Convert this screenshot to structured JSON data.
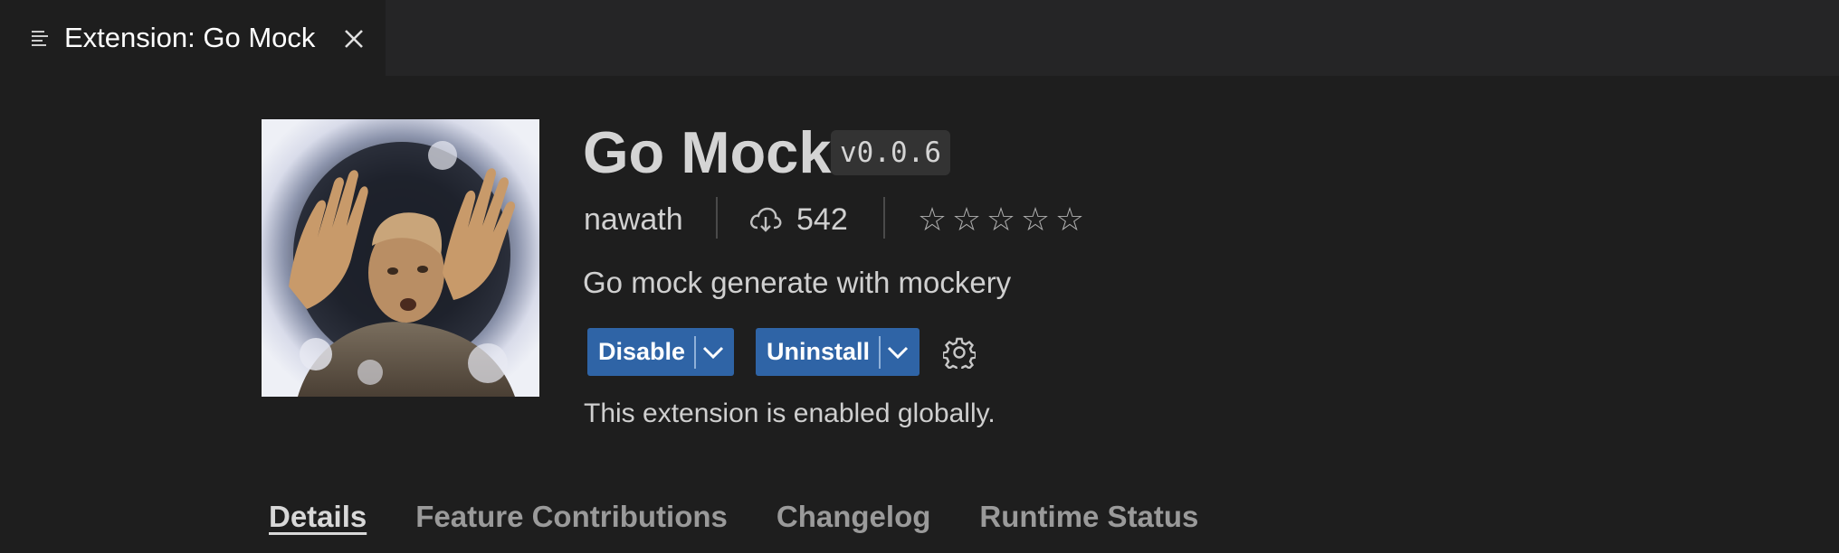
{
  "tab": {
    "title": "Extension: Go Mock",
    "icon": "preview-lines-icon",
    "close_icon": "close-icon"
  },
  "extension": {
    "image_alt": "extension-icon-image",
    "name": "Go Mock",
    "version": "v0.0.6",
    "publisher": "nawath",
    "install_count": "542",
    "rating": {
      "value": 0,
      "max": 5,
      "stars": [
        "☆",
        "☆",
        "☆",
        "☆",
        "☆"
      ]
    },
    "description": "Go mock generate with mockery",
    "status": "This extension is enabled globally."
  },
  "actions": {
    "disable_label": "Disable",
    "uninstall_label": "Uninstall",
    "settings_icon": "gear-icon",
    "button_color": "#2f64a6"
  },
  "detail_tabs": [
    {
      "label": "Details",
      "active": true
    },
    {
      "label": "Feature Contributions",
      "active": false
    },
    {
      "label": "Changelog",
      "active": false
    },
    {
      "label": "Runtime Status",
      "active": false
    }
  ]
}
